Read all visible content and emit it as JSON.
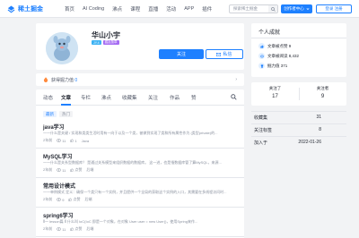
{
  "header": {
    "logo_text": "稀土掘金",
    "nav": [
      "首页",
      "AI Coding",
      "沸点",
      "课程",
      "直播",
      "活动",
      "APP",
      "插件"
    ],
    "search_placeholder": "探索稀土掘金",
    "creator_label": "创作者中心",
    "login_label": "登录 注册"
  },
  "profile": {
    "name": "华山小宇",
    "badges": [
      "JY.4",
      "掘友勋章"
    ],
    "follow_label": "关注",
    "message_label": "私信"
  },
  "jp_bar": {
    "label": "获得掘力值",
    "value": "0"
  },
  "tabs": [
    "动态",
    "文章",
    "专栏",
    "沸点",
    "收藏集",
    "关注",
    "作品",
    "赞"
  ],
  "filters": [
    "最新",
    "热门"
  ],
  "articles": [
    {
      "title": "java学习",
      "abstract": "一一什么是关键 / 实现和类类生活时用有一向于以及一个类，被做到实现了类和所有属性作为 (类型private)的...",
      "date": "2年前",
      "views": "11",
      "likes": "1",
      "tag": "Java"
    },
    {
      "title": "MySQL学习",
      "abstract": "一一什么是关系型数据库？ 是通过关系模型来组织数据的数据库。 这一进，也是指数据库管了算MySQL，来源...",
      "date": "2年前",
      "views": "11",
      "likes": "点赞",
      "tag": "后端"
    },
    {
      "title": "常用设计模式",
      "abstract": "一一单例模式 定义：确保一个类只有一个实例，并且提供一个全局的获取这个实例的入口，其需要在多线程访问时...",
      "date": "2年前",
      "views": "9",
      "likes": "点赞",
      "tag": "后端"
    },
    {
      "title": "spring6学习",
      "abstract": "Ⅱ一 lesson篇 Ⅱ 什么叫 IoC(IoC 即是一个对象，在对象 User user = new User()，使用Spring来作...",
      "date": "2年前",
      "views": "11",
      "likes": "点赞",
      "tag": "后端"
    }
  ],
  "achievements": {
    "title": "个人成就",
    "items": [
      {
        "label": "文章被点赞 9"
      },
      {
        "label": "文章被阅读 8,432"
      },
      {
        "label": "掘力值 371"
      }
    ]
  },
  "follow_stats": [
    {
      "label": "关注了",
      "value": "17"
    },
    {
      "label": "关注者",
      "value": "9"
    }
  ],
  "side_list": [
    {
      "label": "收藏集",
      "value": "31"
    },
    {
      "label": "关注标签",
      "value": "8"
    },
    {
      "label": "加入于",
      "value": "2022-01-26"
    }
  ],
  "colors": {
    "brand": "#1e80ff",
    "page_bg": "#f2f3f5"
  }
}
